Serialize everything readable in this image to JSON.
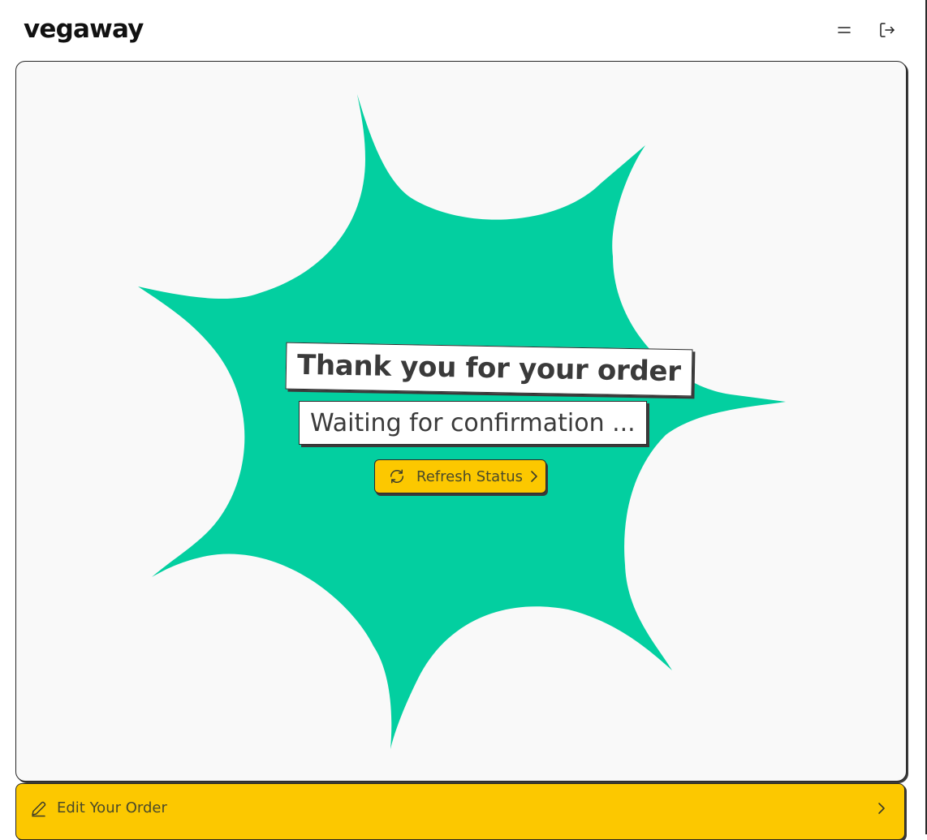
{
  "header": {
    "logo": "vegaway",
    "menu_icon": "menu-icon",
    "logout_icon": "logout-icon"
  },
  "main": {
    "title": "Thank you for your order",
    "status": "Waiting for confirmation ...",
    "refresh_label": "Refresh Status",
    "refresh_icon": "refresh-icon",
    "refresh_chevron": "chevron-right-icon"
  },
  "footer": {
    "edit_label": "Edit Your Order",
    "edit_icon": "pencil-icon",
    "edit_chevron": "chevron-right-icon"
  },
  "colors": {
    "accent_green": "#03cfa0",
    "accent_yellow": "#fcc800",
    "background": "#f9f9f9",
    "border": "#262626"
  }
}
